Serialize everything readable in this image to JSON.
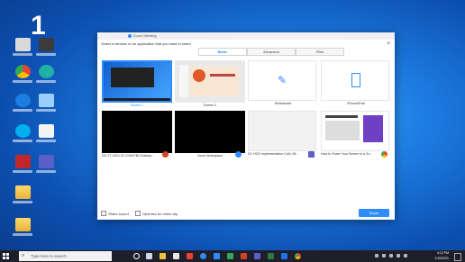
{
  "step_number": "1",
  "share_dialog": {
    "app_title": "Zoom Meeting",
    "instruction": "Select a window or an application that you want to share",
    "tabs": [
      "Basic",
      "Advanced",
      "Files"
    ],
    "active_tab": "Basic",
    "tiles": [
      {
        "label": "Screen 1",
        "kind": "screen",
        "selected": true
      },
      {
        "label": "Screen 2",
        "kind": "slides",
        "selected": false
      },
      {
        "label": "Whiteboard",
        "kind": "whiteboard",
        "selected": false
      },
      {
        "label": "iPhone/iPad",
        "kind": "iphone",
        "selected": false
      },
      {
        "label": "DO-TT-2021.2C.CSM.FBO.Katsirp...",
        "kind": "black",
        "selected": false,
        "badge_color": "#d04423"
      },
      {
        "label": "Zoom Workspace",
        "kind": "black",
        "selected": false,
        "badge_color": "#2d8cff"
      },
      {
        "label": "DC HCB Implementation Call | Mi...",
        "kind": "blank",
        "selected": false,
        "badge_color": "#5b5fc7"
      },
      {
        "label": "How to Share Your Screen in a Zo...",
        "kind": "web",
        "selected": false,
        "badge_color": "#e94235"
      }
    ],
    "share_sound_label": "Share sound",
    "optimize_label": "Optimize for video clip",
    "share_button": "Share"
  },
  "taskbar": {
    "search_placeholder": "Type here to search",
    "time": "4:12 PM",
    "date": "1/19/2021"
  },
  "colors": {
    "accent": "#2d8cff"
  }
}
